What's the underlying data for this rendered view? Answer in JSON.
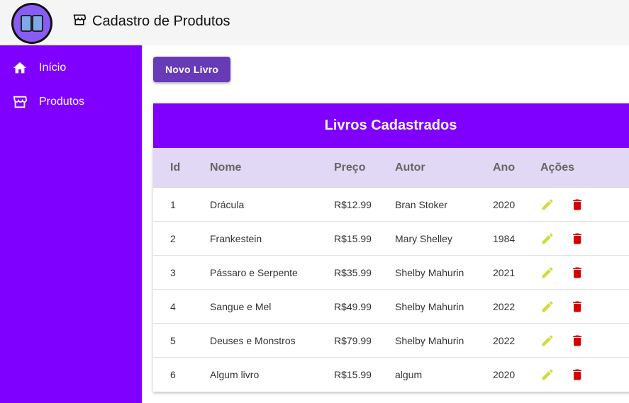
{
  "header": {
    "title": "Cadastro de Produtos",
    "logo_icon": "book-icon",
    "title_icon": "store-icon"
  },
  "sidebar": {
    "items": [
      {
        "label": "Início",
        "icon": "home-icon"
      },
      {
        "label": "Produtos",
        "icon": "store-icon"
      }
    ]
  },
  "toolbar": {
    "new_label": "Novo Livro"
  },
  "table": {
    "title": "Livros Cadastrados",
    "headers": {
      "id": "Id",
      "nome": "Nome",
      "preco": "Preço",
      "autor": "Autor",
      "ano": "Ano",
      "acoes": "Ações"
    },
    "rows": [
      {
        "id": "1",
        "nome": "Drácula",
        "preco": "R$12.99",
        "autor": "Bran Stoker",
        "ano": "2020"
      },
      {
        "id": "2",
        "nome": "Frankestein",
        "preco": "R$15.99",
        "autor": "Mary Shelley",
        "ano": "1984"
      },
      {
        "id": "3",
        "nome": "Pássaro e Serpente",
        "preco": "R$35.99",
        "autor": "Shelby Mahurin",
        "ano": "2021"
      },
      {
        "id": "4",
        "nome": "Sangue e Mel",
        "preco": "R$49.99",
        "autor": "Shelby Mahurin",
        "ano": "2022"
      },
      {
        "id": "5",
        "nome": "Deuses e Monstros",
        "preco": "R$79.99",
        "autor": "Shelby Mahurin",
        "ano": "2022"
      },
      {
        "id": "6",
        "nome": "Algum livro",
        "preco": "R$15.99",
        "autor": "algum",
        "ano": "2020"
      }
    ]
  },
  "colors": {
    "sidebar": "#7f00ff",
    "button": "#673ab7",
    "header_row": "#e0d8f5",
    "edit": "#cddc39",
    "delete": "#d50000"
  }
}
